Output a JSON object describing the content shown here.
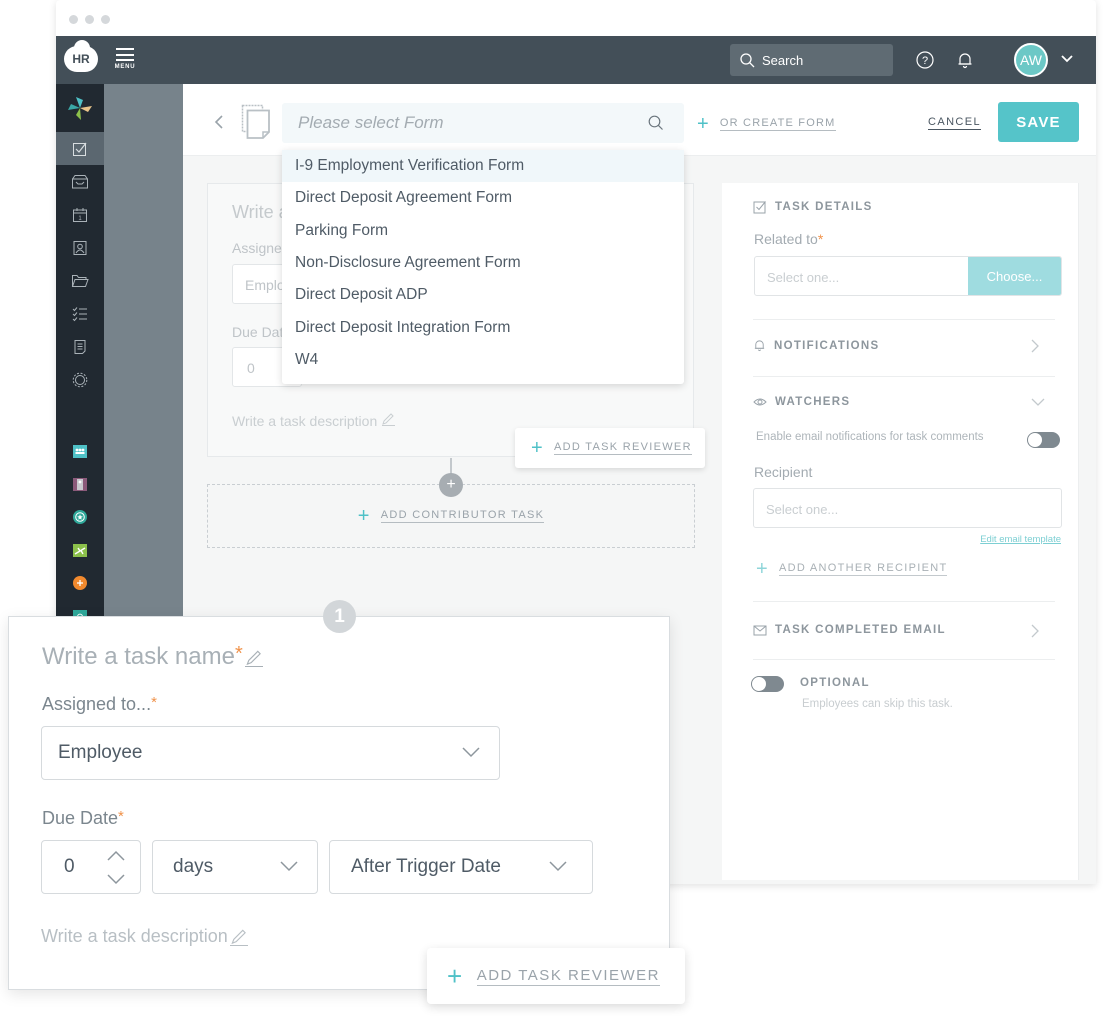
{
  "app": {
    "logo_text": "HR",
    "menu_label": "MENU",
    "search_placeholder": "Search",
    "avatar_initials": "AW"
  },
  "sidebar": {
    "items": [
      {
        "icon": "checkbox-icon",
        "active": true
      },
      {
        "icon": "inbox-icon"
      },
      {
        "icon": "calendar-icon"
      },
      {
        "icon": "contact-card-icon"
      },
      {
        "icon": "folder-icon"
      },
      {
        "icon": "checklist-icon"
      },
      {
        "icon": "document-icon"
      },
      {
        "icon": "gear-icon"
      }
    ],
    "apps": [
      {
        "icon": "team-app-icon",
        "color": "#4fc1c7"
      },
      {
        "icon": "badge-app-icon",
        "color": "#8b5a7a"
      },
      {
        "icon": "award-app-icon",
        "color": "#2fa89a"
      },
      {
        "icon": "travel-app-icon",
        "color": "#8cc04b"
      },
      {
        "icon": "add-app-icon",
        "color": "#f28a2e"
      },
      {
        "icon": "settings-app-icon",
        "color": "#2fa89a"
      }
    ]
  },
  "header": {
    "form_placeholder": "Please select Form",
    "create_form_label": "OR CREATE FORM",
    "cancel_label": "CANCEL",
    "save_label": "SAVE"
  },
  "form_dropdown": {
    "options": [
      "I-9 Employment Verification Form",
      "Direct Deposit Agreement Form",
      "Parking Form",
      "Non-Disclosure Agreement Form",
      "Direct Deposit ADP",
      "Direct Deposit Integration Form",
      "W4"
    ],
    "highlighted_index": 0
  },
  "background_card": {
    "title_partial": "Write a",
    "assigned_partial": "Assigne",
    "employee_partial": "Emplo",
    "due_partial": "Due Dat",
    "due_value": "0",
    "description": "Write a task description"
  },
  "add_task_reviewer_label": "ADD TASK REVIEWER",
  "add_contributor_label": "ADD CONTRIBUTOR TASK",
  "task_card": {
    "step_number": "1",
    "name_placeholder": "Write a task name",
    "required_mark": "*",
    "assigned_label": "Assigned to...",
    "assigned_value": "Employee",
    "due_label": "Due Date",
    "due_amount": "0",
    "due_unit": "days",
    "due_relation": "After Trigger Date",
    "description_placeholder": "Write a task description"
  },
  "right_panel": {
    "task_details_title": "TASK DETAILS",
    "related_label": "Related to",
    "related_placeholder": "Select one...",
    "choose_label": "Choose...",
    "notifications_title": "NOTIFICATIONS",
    "watchers_title": "WATCHERS",
    "email_notif_label": "Enable email notifications for task comments",
    "email_notif_enabled": false,
    "recipient_label": "Recipient",
    "recipient_placeholder": "Select one...",
    "edit_template_label": "Edit email template",
    "add_recipient_label": "ADD ANOTHER RECIPIENT",
    "completed_email_title": "TASK COMPLETED EMAIL",
    "optional_title": "OPTIONAL",
    "optional_subtitle": "Employees can skip this task.",
    "optional_enabled": false
  }
}
